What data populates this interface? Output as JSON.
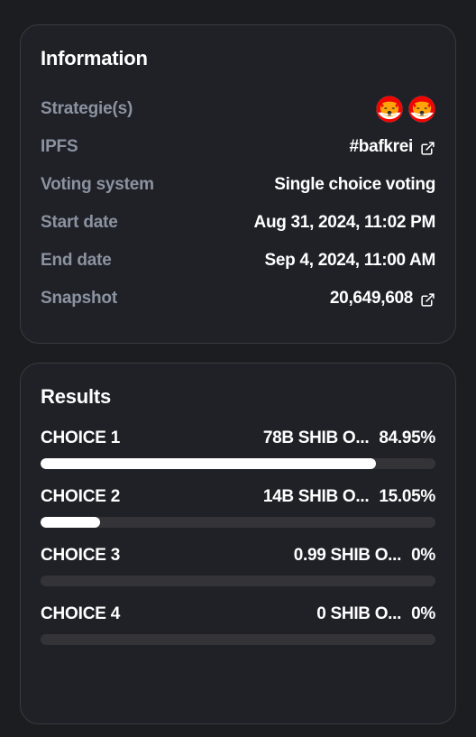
{
  "theme": {
    "page_background": "#1c1d21",
    "card_background": "#202127",
    "card_border": "#39393f",
    "label_color": "#8b93a1",
    "value_color": "#ffffff",
    "bar_track_color": "#333338",
    "bar_fill_color": "#ffffff"
  },
  "information": {
    "title": "Information",
    "rows": [
      {
        "label": "Strategie(s)",
        "type": "avatars",
        "avatars": [
          "shib-token-icon",
          "shib-token-icon"
        ]
      },
      {
        "label": "IPFS",
        "type": "link",
        "value": "#bafkrei",
        "icon": "external-link-icon"
      },
      {
        "label": "Voting system",
        "type": "text",
        "value": "Single choice voting"
      },
      {
        "label": "Start date",
        "type": "text",
        "value": "Aug 31, 2024, 11:02 PM"
      },
      {
        "label": "End date",
        "type": "text",
        "value": "Sep 4, 2024, 11:00 AM"
      },
      {
        "label": "Snapshot",
        "type": "link",
        "value": "20,649,608",
        "icon": "external-link-icon"
      }
    ]
  },
  "results": {
    "title": "Results",
    "choices": [
      {
        "name": "CHOICE 1",
        "amount": "78B SHIB O...",
        "percent_label": "84.95%",
        "percent": 84.95
      },
      {
        "name": "CHOICE 2",
        "amount": "14B SHIB O...",
        "percent_label": "15.05%",
        "percent": 15.05
      },
      {
        "name": "CHOICE 3",
        "amount": "0.99 SHIB O...",
        "percent_label": "0%",
        "percent": 0
      },
      {
        "name": "CHOICE 4",
        "amount": "0 SHIB O...",
        "percent_label": "0%",
        "percent": 0
      }
    ]
  }
}
